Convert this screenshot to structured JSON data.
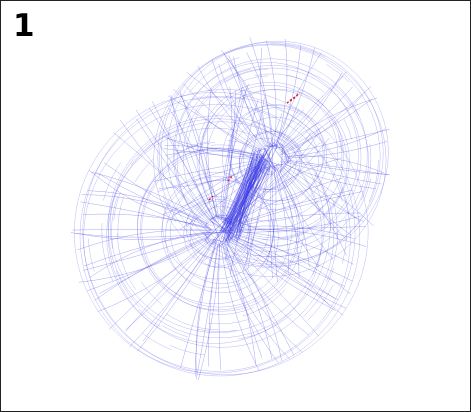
{
  "panel_label": "1",
  "colors": {
    "background": "#ffffff",
    "border": "#222222",
    "edge": "#3a3ae6",
    "highlight": "#e0141e"
  },
  "hubs": [
    {
      "name": "hub-upper-right"
    },
    {
      "name": "hub-lower-left"
    }
  ]
}
